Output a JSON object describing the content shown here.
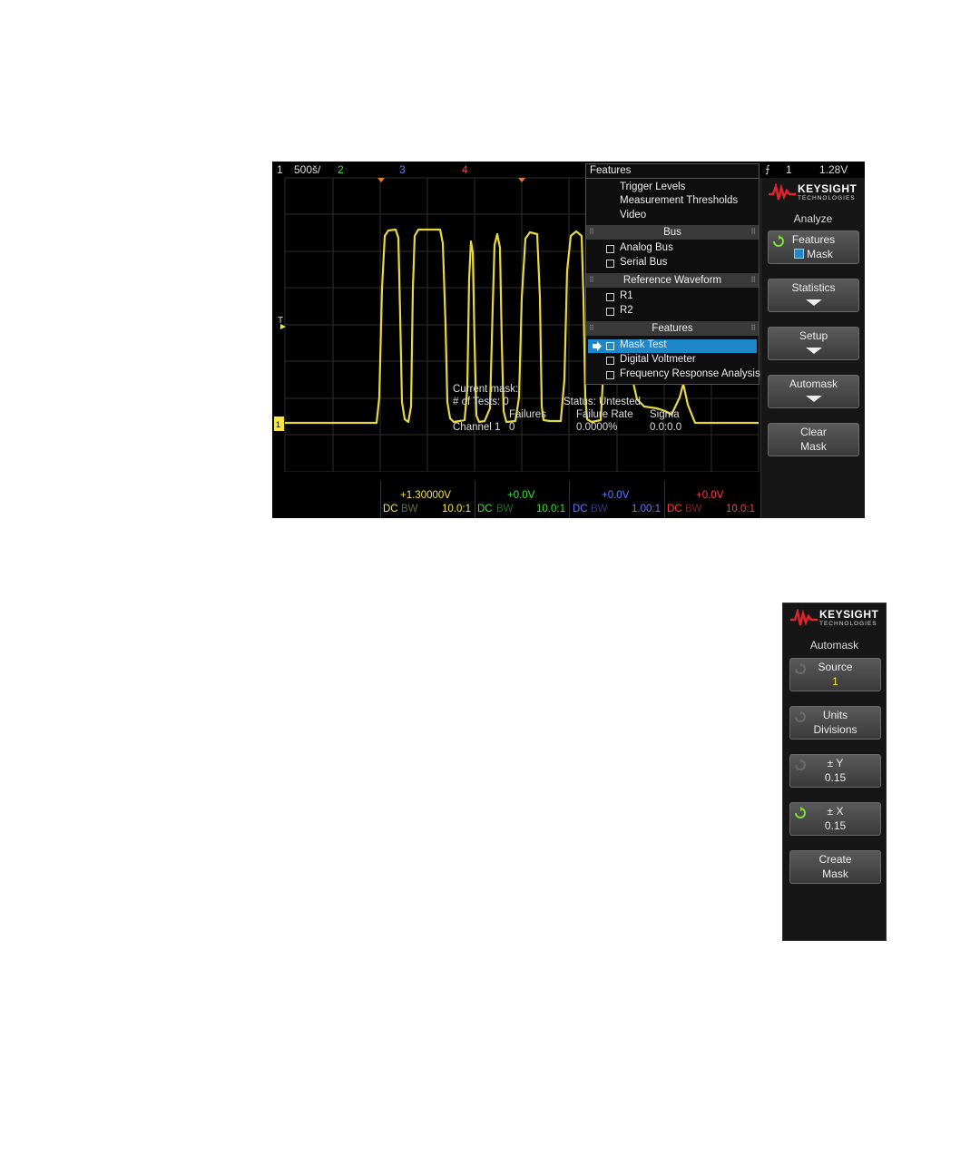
{
  "status_bar": {
    "ch1_num": "1",
    "ch1_scale": "500š/",
    "ch2": "2",
    "ch3": "3",
    "ch4": "4",
    "trigger_source": "1",
    "trigger_level": "1.28V"
  },
  "features_menu": {
    "title": "Features",
    "top_items": [
      "Trigger Levels",
      "Measurement Thresholds",
      "Video"
    ],
    "bus_header": "Bus",
    "bus_items": [
      "Analog Bus",
      "Serial Bus"
    ],
    "ref_header": "Reference Waveform",
    "ref_items": [
      "R1",
      "R2"
    ],
    "features_header": "Features",
    "feature_items": [
      "Mask Test",
      "Digital Voltmeter",
      "Frequency Response Analysis"
    ],
    "selected_item": "Mask Test"
  },
  "mask_info": {
    "current_mask": "Current mask:",
    "tests_label": "# of Tests: 0",
    "status_label": "Status: Untested",
    "col_failures": "Failures",
    "col_failure_rate": "Failure Rate",
    "col_sigma": "Sigma",
    "row_channel": "Channel 1",
    "row_failures": "0",
    "row_failure_rate": "0.0000%",
    "row_sigma": "0.0:0.0"
  },
  "analyze_panel": {
    "logo_brand": "KEYSIGHT",
    "logo_sub": "TECHNOLOGIES",
    "title": "Analyze",
    "softkeys": [
      {
        "line1": "Features",
        "line2": "Mask"
      },
      {
        "line1": "Statistics"
      },
      {
        "line1": "Setup"
      },
      {
        "line1": "Automask"
      },
      {
        "line1": "Clear",
        "line2": "Mask"
      }
    ]
  },
  "channel_readouts": [
    {
      "offset": "+1.30000V",
      "coupling": "DC",
      "bw": "BW",
      "probe": "10.0:1",
      "color": "#f5e642"
    },
    {
      "offset": "+0.0V",
      "coupling": "DC",
      "bw": "BW",
      "probe": "10.0:1",
      "color": "#3fe03f"
    },
    {
      "offset": "+0.0V",
      "coupling": "DC",
      "bw": "BW",
      "probe": "1.00:1",
      "color": "#5a7bff"
    },
    {
      "offset": "+0.0V",
      "coupling": "DC",
      "bw": "BW",
      "probe": "10.0:1",
      "color": "#ff3b3b"
    }
  ],
  "automask_panel": {
    "logo_brand": "KEYSIGHT",
    "logo_sub": "TECHNOLOGIES",
    "title": "Automask",
    "softkeys": [
      {
        "line1": "Source",
        "line2": "1"
      },
      {
        "line1": "Units",
        "line2": "Divisions"
      },
      {
        "line1": "± Y",
        "line2": "0.15"
      },
      {
        "line1": "± X",
        "line2": "0.15"
      },
      {
        "line1": "Create",
        "line2": "Mask"
      }
    ]
  },
  "colors": {
    "ch1": "#f5e642",
    "ch2": "#3fe03f",
    "ch3": "#5a7bff",
    "ch4": "#ff3b3b",
    "highlight": "#1d87c9",
    "logo_red": "#e0242c"
  }
}
